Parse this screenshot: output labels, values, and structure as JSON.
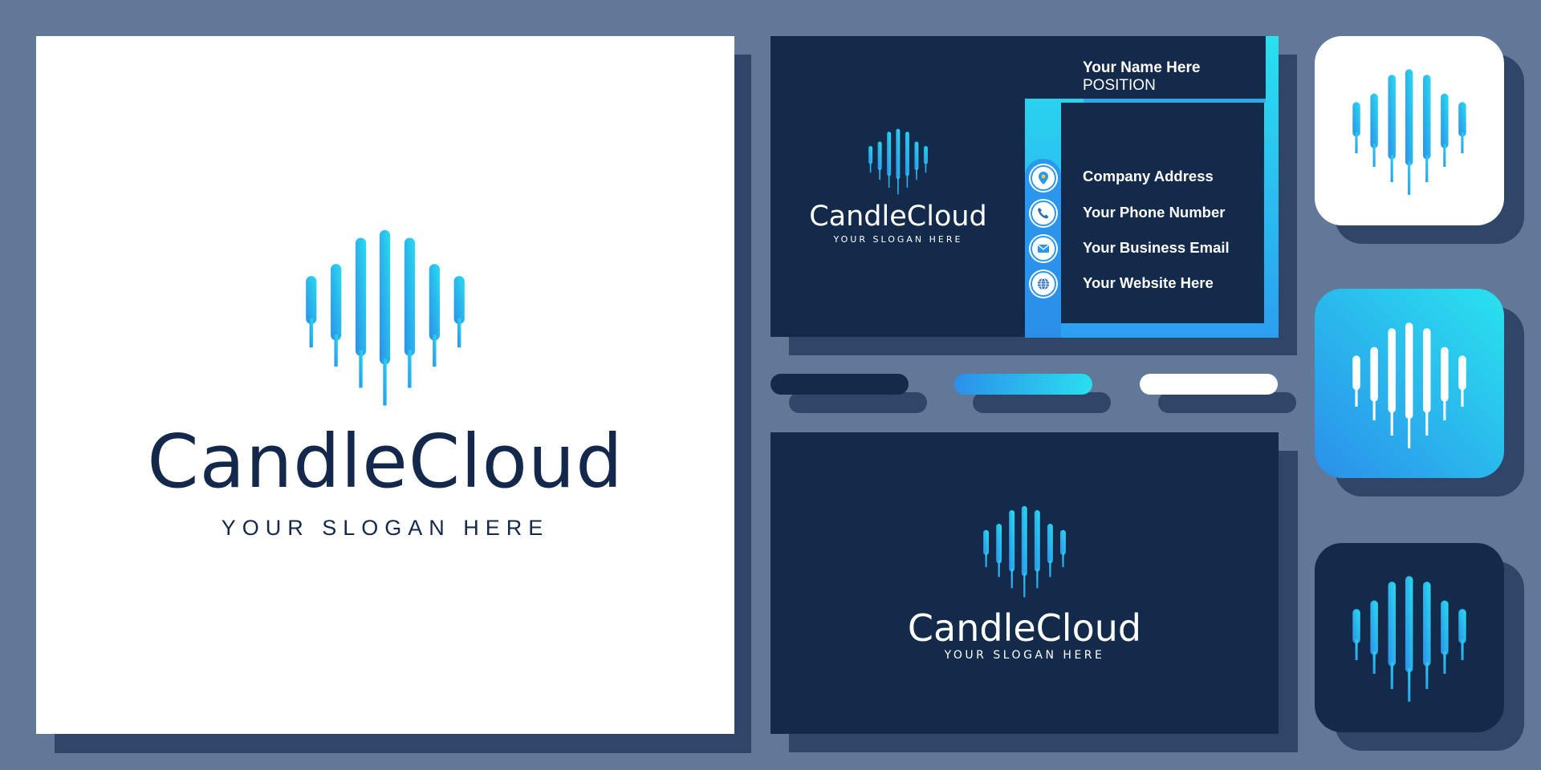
{
  "brand": {
    "name": "CandleCloud",
    "slogan": "YOUR SLOGAN HERE"
  },
  "colors": {
    "background": "#627898",
    "shadow": "#2f4668",
    "navy": "#132a4b",
    "white": "#ffffff",
    "gradient_start": "#2b8fea",
    "gradient_end": "#29e0ef"
  },
  "business_card": {
    "name": "Your Name Here",
    "position": "POSITION",
    "contacts": [
      {
        "icon": "location-pin-icon",
        "label": "Company Address"
      },
      {
        "icon": "phone-icon",
        "label": "Your Phone Number"
      },
      {
        "icon": "envelope-icon",
        "label": "Your Business Email"
      },
      {
        "icon": "globe-icon",
        "label": "Your Website Here"
      }
    ]
  },
  "swatches": [
    {
      "name": "navy",
      "color": "#132a4b"
    },
    {
      "name": "gradient-blue",
      "color": "#2b9ff0"
    },
    {
      "name": "white",
      "color": "#ffffff"
    }
  ],
  "app_icons": [
    {
      "variant": "white"
    },
    {
      "variant": "gradient"
    },
    {
      "variant": "navy"
    }
  ]
}
